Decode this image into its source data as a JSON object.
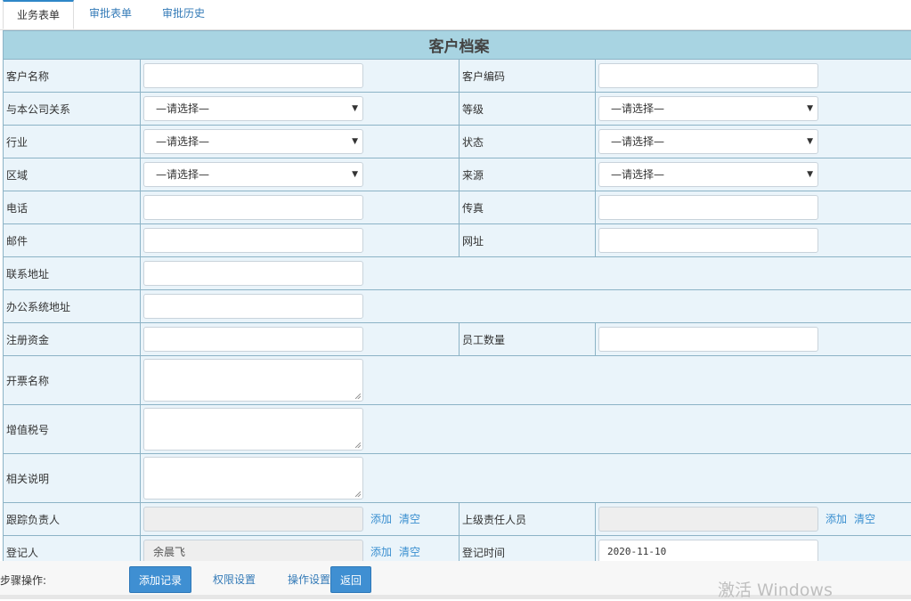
{
  "tabs": [
    {
      "label": "业务表单"
    },
    {
      "label": "审批表单"
    },
    {
      "label": "审批历史"
    }
  ],
  "form": {
    "title": "客户档案",
    "placeholder_select": "—请选择—",
    "labels": {
      "customer_name": "客户名称",
      "customer_code": "客户编码",
      "relation": "与本公司关系",
      "level": "等级",
      "industry": "行业",
      "status": "状态",
      "region": "区域",
      "source": "来源",
      "phone": "电话",
      "fax": "传真",
      "email": "邮件",
      "website": "网址",
      "address": "联系地址",
      "office_address": "办公系统地址",
      "capital": "注册资金",
      "employees": "员工数量",
      "invoice_name": "开票名称",
      "tax_no": "增值税号",
      "notes": "相关说明",
      "follower": "跟踪负责人",
      "superior": "上级责任人员",
      "registrar": "登记人",
      "reg_time": "登记时间"
    },
    "values": {
      "registrar": "余晨飞",
      "reg_time": "2020-11-10"
    },
    "add_link": "添加",
    "clear_link": "清空"
  },
  "stepbar": {
    "label": "步骤操作:",
    "add_record": "添加记录",
    "permissions": "权限设置",
    "operations": "操作设置",
    "back": "返回"
  },
  "watermark": "激活 Windows"
}
